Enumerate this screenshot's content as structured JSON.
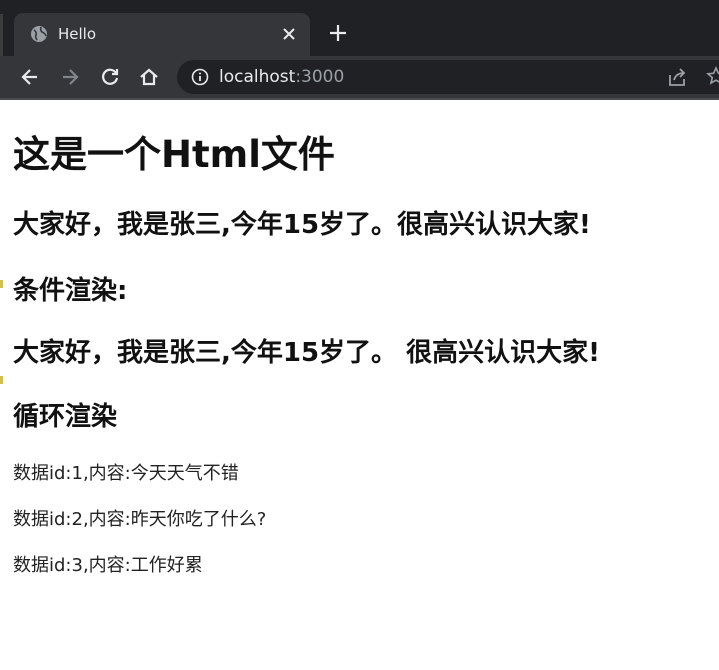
{
  "browser": {
    "tab": {
      "title": "Hello",
      "icon": "globe-icon"
    },
    "address": {
      "host": "localhost",
      "port": ":3000"
    }
  },
  "page": {
    "title": "这是一个Html文件",
    "greeting": "大家好，我是张三,今年15岁了。很高兴认识大家!",
    "conditional_heading": "条件渲染:",
    "conditional_text": "大家好，我是张三,今年15岁了。 很高兴认识大家!",
    "loop_heading": "循环渲染",
    "items": [
      "数据id:1,内容:今天天气不错",
      "数据id:2,内容:昨天你吃了什么?",
      "数据id:3,内容:工作好累"
    ]
  },
  "colors": {
    "chrome_dark": "#202124",
    "chrome_tab": "#35363a",
    "text_light": "#e8eaed"
  }
}
